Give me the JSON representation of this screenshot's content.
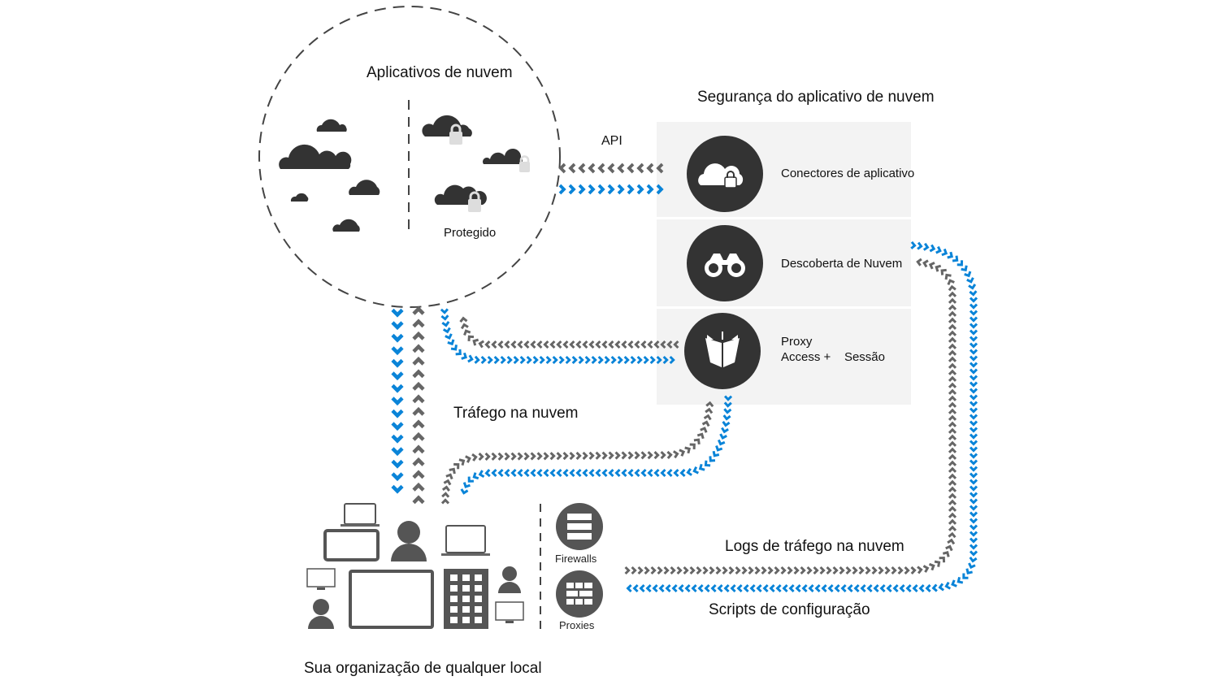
{
  "diagram": {
    "cloud_apps": {
      "title": "Aplicativos de nuvem",
      "protected_label": "Protegido"
    },
    "security": {
      "title": "Segurança do aplicativo de nuvem",
      "components": [
        {
          "label": "Conectores de aplicativo",
          "icon": "cloud-lock-icon"
        },
        {
          "label": "Descoberta de Nuvem",
          "icon": "binoculars-icon"
        },
        {
          "label_line1": "Proxy",
          "label_line2": "Access +    Sessão",
          "icon": "proxy-book-icon"
        }
      ]
    },
    "flows": {
      "api": "API",
      "cloud_traffic": "Tráfego na nuvem",
      "traffic_logs": "Logs de tráfego na nuvem",
      "config_scripts": "Scripts de configuração"
    },
    "organization": {
      "title": "Sua organização de qualquer local",
      "firewalls": "Firewalls",
      "proxies": "Proxies"
    },
    "colors": {
      "blue": "#0a84d8",
      "gray": "#666666",
      "dark": "#333333",
      "panel": "#f3f3f3"
    }
  }
}
